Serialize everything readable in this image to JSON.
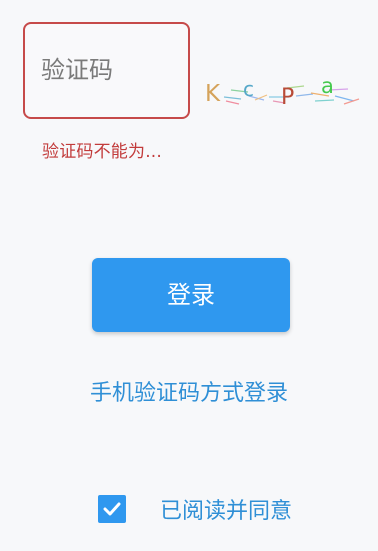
{
  "captcha": {
    "placeholder": "验证码",
    "value": "",
    "image_text": "KcPa"
  },
  "validation": {
    "captcha_error": "验证码不能为..."
  },
  "actions": {
    "login_label": "登录",
    "sms_login_label": "手机验证码方式登录"
  },
  "agreement": {
    "checked": true,
    "label": "已阅读并同意"
  },
  "colors": {
    "primary": "#2f98ef",
    "error": "#c64a4a",
    "link": "#2f8fd6",
    "background": "#f7f8fa"
  }
}
